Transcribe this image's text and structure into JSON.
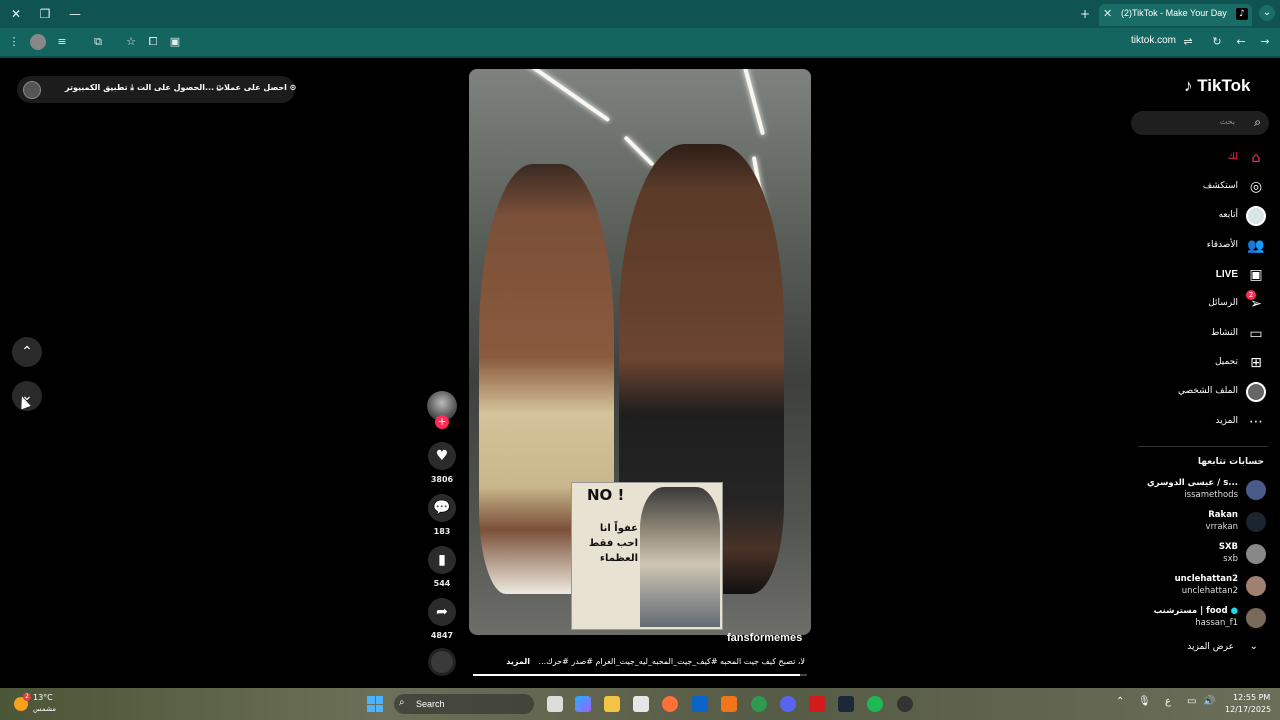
{
  "browser": {
    "tab_title": "(2)TikTok - Make Your Day",
    "address": "tiktok.com",
    "icons": [
      "close-icon",
      "restore-icon",
      "minimize-icon",
      "new-tab-icon",
      "tab-close-icon",
      "tab-list-icon",
      "menu-icon",
      "profile-icon",
      "media-icon",
      "extensions-icon",
      "bookmark-star-icon",
      "tab-search-icon",
      "split-view-icon",
      "site-settings-icon",
      "reload-icon",
      "back-icon",
      "forward-icon"
    ]
  },
  "promo": {
    "get_coins": "احصل على عملات",
    "get_app": "الحصول على الت...",
    "pc_app": "تطبيق الكمبيوتر"
  },
  "video": {
    "author": "fansformemes",
    "caption": "لا، تصبح كيف جيت المحبه #كيف_جيت_المحبه_ليه_جيت_الغرام #صدر #حرك...",
    "more": "المزيد",
    "meme_no": "NO !",
    "meme_text": "عفواً انا احب فقط العظماء",
    "progress": 0.98
  },
  "actions": {
    "likes": "3806",
    "comments": "183",
    "saves": "544",
    "shares": "4847"
  },
  "sidebar": {
    "logo": "TikTok",
    "search_placeholder": "بحث",
    "nav": [
      {
        "label": "لك",
        "icon": "home-icon"
      },
      {
        "label": "استكشف",
        "icon": "explore-icon"
      },
      {
        "label": "أتابعه",
        "icon": "following-avatar"
      },
      {
        "label": "الأصدقاء",
        "icon": "friends-icon"
      },
      {
        "label": "LIVE",
        "icon": "live-icon"
      },
      {
        "label": "الرسائل",
        "icon": "messages-icon",
        "badge": "2"
      },
      {
        "label": "النشاط",
        "icon": "activity-icon"
      },
      {
        "label": "تحميل",
        "icon": "upload-icon"
      },
      {
        "label": "الملف الشخصي",
        "icon": "profile-avatar"
      },
      {
        "label": "المزيد",
        "icon": "more-icon"
      }
    ],
    "following_title": "حسابات تتابعها",
    "following": [
      {
        "name": "عيسى الدوسري / s...",
        "handle": "issamethods"
      },
      {
        "name": "Rakan",
        "handle": "vrrakan"
      },
      {
        "name": "SXB",
        "handle": "sxb"
      },
      {
        "name": "unclehattan2",
        "handle": "unclehattan2"
      },
      {
        "name": "مسترشنب | food",
        "handle": "hassan_f1"
      }
    ],
    "see_more": "عرض المزيد"
  },
  "taskbar": {
    "temp": "13°C",
    "weather": "مشمس",
    "weather_badge": "2",
    "search": "Search",
    "time": "12:55 PM",
    "date": "12/17/2025",
    "lang": "ع"
  },
  "colors": {
    "accent": "#fe2c55",
    "tabbar": "#0f5450",
    "toolbar": "#146460"
  }
}
